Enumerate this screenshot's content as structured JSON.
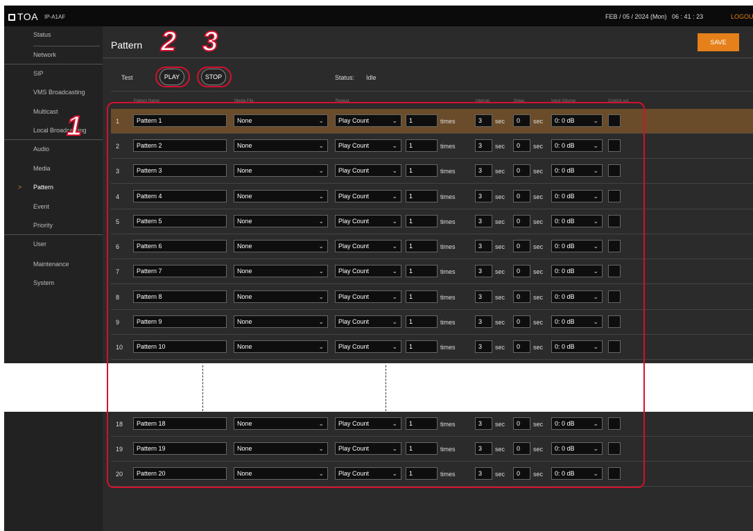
{
  "header": {
    "brand": "TOA",
    "model": "IP-A1AF",
    "datetime": "FEB / 05 / 2024 (Mon)   06 : 41 : 23",
    "logout": "LOGOUT"
  },
  "sidebar": {
    "items": [
      {
        "label": "Status"
      },
      {
        "label": "Network"
      },
      {
        "label": "SIP"
      },
      {
        "label": "VMS Broadcasting"
      },
      {
        "label": "Multicast"
      },
      {
        "label": "Local Broadcasting"
      },
      {
        "label": "Audio"
      },
      {
        "label": "Media"
      },
      {
        "label": "Pattern",
        "active": true
      },
      {
        "label": "Event"
      },
      {
        "label": "Priority"
      },
      {
        "label": "User"
      },
      {
        "label": "Maintenance"
      },
      {
        "label": "System"
      }
    ],
    "active_marker": ">"
  },
  "main": {
    "title": "Pattern",
    "save_label": "SAVE",
    "test_label": "Test",
    "play_label": "PLAY",
    "stop_label": "STOP",
    "status_label": "Status:",
    "status_value": "Idle",
    "columns": [
      "Pattern Name",
      "Media File",
      "Repeat",
      "Interval",
      "Delay",
      "Input Volume",
      "Control out"
    ],
    "rows": [
      {
        "no": "1",
        "name": "Pattern 1",
        "media": "None",
        "repeat": "Play Count",
        "count": "1",
        "times": "times",
        "interval": "3",
        "sec1": "sec",
        "delay": "0",
        "sec2": "sec",
        "volume": "0: 0 dB",
        "selected": true
      },
      {
        "no": "2",
        "name": "Pattern 2",
        "media": "None",
        "repeat": "Play Count",
        "count": "1",
        "times": "times",
        "interval": "3",
        "sec1": "sec",
        "delay": "0",
        "sec2": "sec",
        "volume": "0: 0 dB"
      },
      {
        "no": "3",
        "name": "Pattern 3",
        "media": "None",
        "repeat": "Play Count",
        "count": "1",
        "times": "times",
        "interval": "3",
        "sec1": "sec",
        "delay": "0",
        "sec2": "sec",
        "volume": "0: 0 dB"
      },
      {
        "no": "4",
        "name": "Pattern 4",
        "media": "None",
        "repeat": "Play Count",
        "count": "1",
        "times": "times",
        "interval": "3",
        "sec1": "sec",
        "delay": "0",
        "sec2": "sec",
        "volume": "0: 0 dB"
      },
      {
        "no": "5",
        "name": "Pattern 5",
        "media": "None",
        "repeat": "Play Count",
        "count": "1",
        "times": "times",
        "interval": "3",
        "sec1": "sec",
        "delay": "0",
        "sec2": "sec",
        "volume": "0: 0 dB"
      },
      {
        "no": "6",
        "name": "Pattern 6",
        "media": "None",
        "repeat": "Play Count",
        "count": "1",
        "times": "times",
        "interval": "3",
        "sec1": "sec",
        "delay": "0",
        "sec2": "sec",
        "volume": "0: 0 dB"
      },
      {
        "no": "7",
        "name": "Pattern 7",
        "media": "None",
        "repeat": "Play Count",
        "count": "1",
        "times": "times",
        "interval": "3",
        "sec1": "sec",
        "delay": "0",
        "sec2": "sec",
        "volume": "0: 0 dB"
      },
      {
        "no": "8",
        "name": "Pattern 8",
        "media": "None",
        "repeat": "Play Count",
        "count": "1",
        "times": "times",
        "interval": "3",
        "sec1": "sec",
        "delay": "0",
        "sec2": "sec",
        "volume": "0: 0 dB"
      },
      {
        "no": "9",
        "name": "Pattern 9",
        "media": "None",
        "repeat": "Play Count",
        "count": "1",
        "times": "times",
        "interval": "3",
        "sec1": "sec",
        "delay": "0",
        "sec2": "sec",
        "volume": "0: 0 dB"
      },
      {
        "no": "10",
        "name": "Pattern 10",
        "media": "None",
        "repeat": "Play Count",
        "count": "1",
        "times": "times",
        "interval": "3",
        "sec1": "sec",
        "delay": "0",
        "sec2": "sec",
        "volume": "0: 0 dB"
      },
      {
        "no": "18",
        "name": "Pattern 18",
        "media": "None",
        "repeat": "Play Count",
        "count": "1",
        "times": "times",
        "interval": "3",
        "sec1": "sec",
        "delay": "0",
        "sec2": "sec",
        "volume": "0: 0 dB"
      },
      {
        "no": "19",
        "name": "Pattern 19",
        "media": "None",
        "repeat": "Play Count",
        "count": "1",
        "times": "times",
        "interval": "3",
        "sec1": "sec",
        "delay": "0",
        "sec2": "sec",
        "volume": "0: 0 dB"
      },
      {
        "no": "20",
        "name": "Pattern 20",
        "media": "None",
        "repeat": "Play Count",
        "count": "1",
        "times": "times",
        "interval": "3",
        "sec1": "sec",
        "delay": "0",
        "sec2": "sec",
        "volume": "0: 0 dB"
      }
    ]
  },
  "callouts": {
    "table": "1",
    "play": "2",
    "stop": "3"
  },
  "colors": {
    "accent": "#e5801a",
    "callout": "#d4112e",
    "selected_row": "#6a4c2a",
    "panel": "#2b2b2b",
    "topbar": "#0b0b0b"
  },
  "icons": {
    "select": "chevron-down-icon",
    "active_nav": "chevron-right-icon",
    "logo": "toa-logo-icon"
  }
}
